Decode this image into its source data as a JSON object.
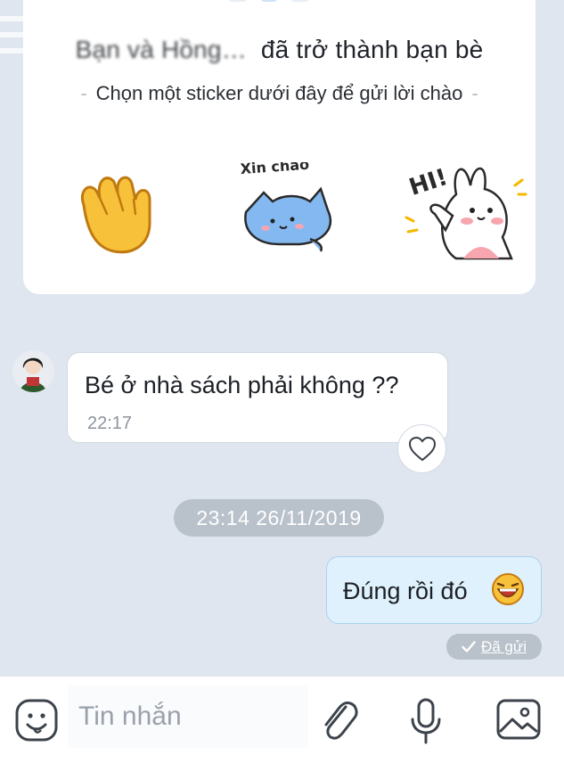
{
  "friend_card": {
    "name": "Bạn và Hồng…",
    "became_friends": "đã trở thành bạn bè",
    "hint": "Chọn một sticker dưới đây để gửi lời chào",
    "stickers": [
      {
        "icon": "waving-hand-icon",
        "caption": ""
      },
      {
        "icon": "cat-xin-chao-icon",
        "caption": "Xin chào"
      },
      {
        "icon": "bunny-hi-icon",
        "caption": "HI!"
      }
    ]
  },
  "incoming": {
    "text": "Bé ở nhà sách phải không ??",
    "time": "22:17"
  },
  "date_separator": "23:14 26/11/2019",
  "outgoing": {
    "text": "Đúng rồi đó",
    "status": "Đã gửi"
  },
  "input_bar": {
    "placeholder": "Tin nhắn"
  },
  "colors": {
    "background": "#dfe6f0",
    "outgoing_bubble": "#dff1fc",
    "pill": "#b9c1cb"
  }
}
